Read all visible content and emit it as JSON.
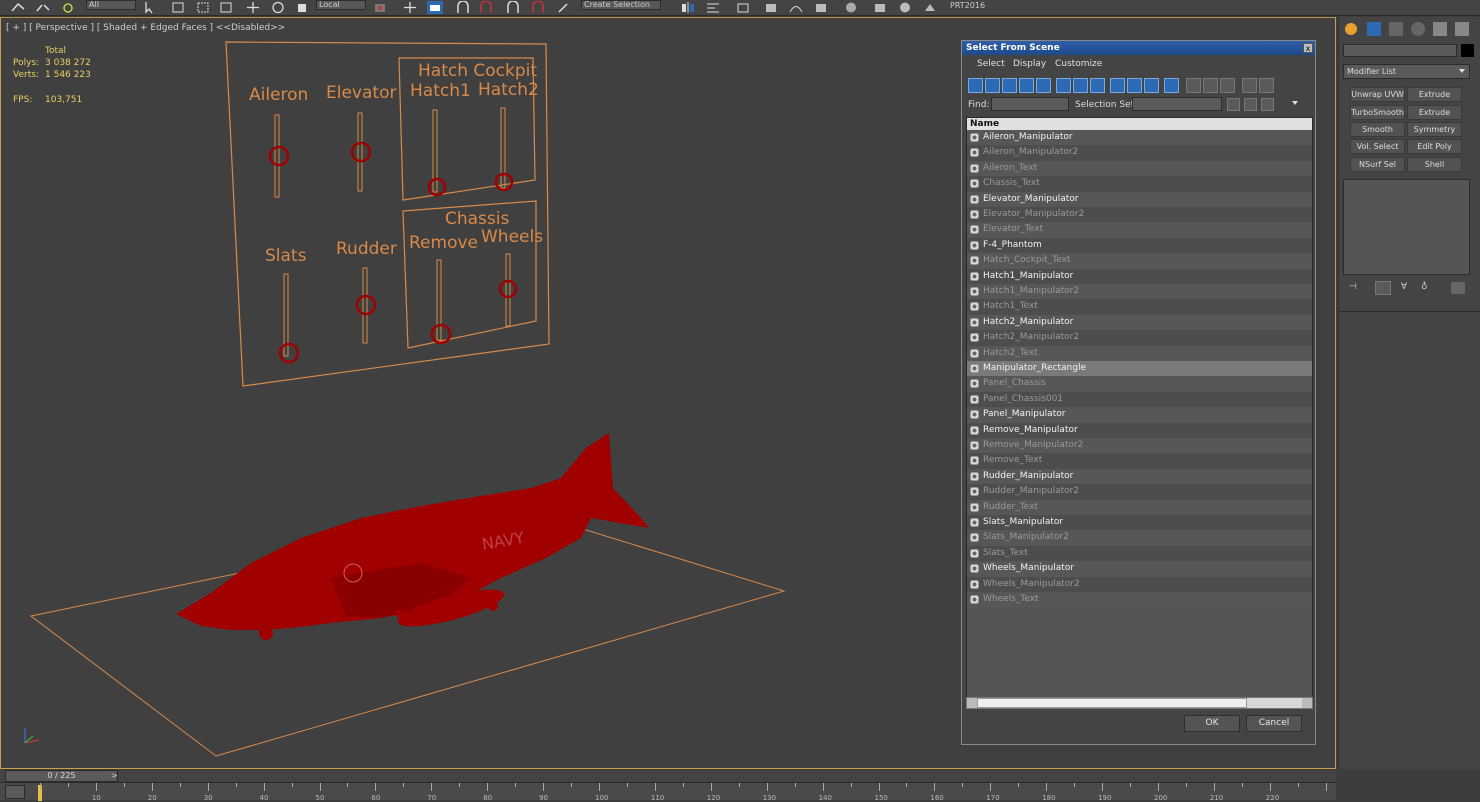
{
  "toolbar": {
    "selection_filter": "All",
    "coord_system": "Local",
    "named_selection": "Create Selection Se",
    "project": "PRT2016"
  },
  "viewport": {
    "label": "[ + ] [ Perspective ] [ Shaded + Edged Faces ] <<Disabled>>",
    "stats_total_label": "Total",
    "polys_label": "Polys:",
    "polys_value": "3 038 272",
    "verts_label": "Verts:",
    "verts_value": "1 546 223",
    "fps_label": "FPS:",
    "fps_value": "103,751",
    "panel_texts": {
      "aileron": "Aileron",
      "elevator": "Elevator",
      "hatch_cockpit": "Hatch Cockpit",
      "hatch1": "Hatch1",
      "hatch2": "Hatch2",
      "slats": "Slats",
      "rudder": "Rudder",
      "chassis": "Chassis",
      "remove": "Remove",
      "wheels": "Wheels"
    },
    "navy_text": "NAVY"
  },
  "dialog": {
    "title": "Select From Scene",
    "close_glyph": "x",
    "menu": [
      "Select",
      "Display",
      "Customize"
    ],
    "find_label": "Find:",
    "selection_set_label": "Selection Set:",
    "column_name": "Name",
    "ok_label": "OK",
    "cancel_label": "Cancel",
    "items": [
      {
        "name": "Aileron_Manipulator",
        "state": "on"
      },
      {
        "name": "Aileron_Manipulator2",
        "state": "off"
      },
      {
        "name": "Aileron_Text",
        "state": "off"
      },
      {
        "name": "Chassis_Text",
        "state": "off"
      },
      {
        "name": "Elevator_Manipulator",
        "state": "on"
      },
      {
        "name": "Elevator_Manipulator2",
        "state": "off"
      },
      {
        "name": "Elevator_Text",
        "state": "off"
      },
      {
        "name": "F-4_Phantom",
        "state": "on"
      },
      {
        "name": "Hatch_Cockpit_Text",
        "state": "off"
      },
      {
        "name": "Hatch1_Manipulator",
        "state": "on"
      },
      {
        "name": "Hatch1_Manipulator2",
        "state": "off"
      },
      {
        "name": "Hatch1_Text",
        "state": "off"
      },
      {
        "name": "Hatch2_Manipulator",
        "state": "on"
      },
      {
        "name": "Hatch2_Manipulator2",
        "state": "off"
      },
      {
        "name": "Hatch2_Text",
        "state": "off"
      },
      {
        "name": "Manipulator_Rectangle",
        "state": "selected"
      },
      {
        "name": "Panel_Chassis",
        "state": "off"
      },
      {
        "name": "Panel_Chassis001",
        "state": "off"
      },
      {
        "name": "Panel_Manipulator",
        "state": "on"
      },
      {
        "name": "Remove_Manipulator",
        "state": "on"
      },
      {
        "name": "Remove_Manipulator2",
        "state": "off"
      },
      {
        "name": "Remove_Text",
        "state": "off"
      },
      {
        "name": "Rudder_Manipulator",
        "state": "on"
      },
      {
        "name": "Rudder_Manipulator2",
        "state": "off"
      },
      {
        "name": "Rudder_Text",
        "state": "off"
      },
      {
        "name": "Slats_Manipulator",
        "state": "on"
      },
      {
        "name": "Slats_Manipulator2",
        "state": "off"
      },
      {
        "name": "Slats_Text",
        "state": "off"
      },
      {
        "name": "Wheels_Manipulator",
        "state": "on"
      },
      {
        "name": "Wheels_Manipulator2",
        "state": "off"
      },
      {
        "name": "Wheels_Text",
        "state": "off"
      }
    ]
  },
  "command_panel": {
    "modifier_list_label": "Modifier List",
    "modifier_buttons": [
      "Unwrap UVW",
      "Extrude",
      "TurboSmooth",
      "Extrude",
      "Smooth",
      "Symmetry",
      "Vol. Select",
      "Edit Poly",
      "NSurf Sel",
      "Shell"
    ]
  },
  "timeline": {
    "slider_label": "0 / 225",
    "ticks": [
      "10",
      "20",
      "30",
      "40",
      "50",
      "60",
      "70",
      "80",
      "90",
      "100",
      "110",
      "120",
      "130",
      "140",
      "150",
      "160",
      "170",
      "180",
      "190",
      "200",
      "210",
      "220"
    ]
  },
  "colors": {
    "wire_red": "#a00000",
    "panel_orange": "#d88a4a",
    "stats_yellow": "#e8d060",
    "title_blue": "#2f5fa8"
  }
}
